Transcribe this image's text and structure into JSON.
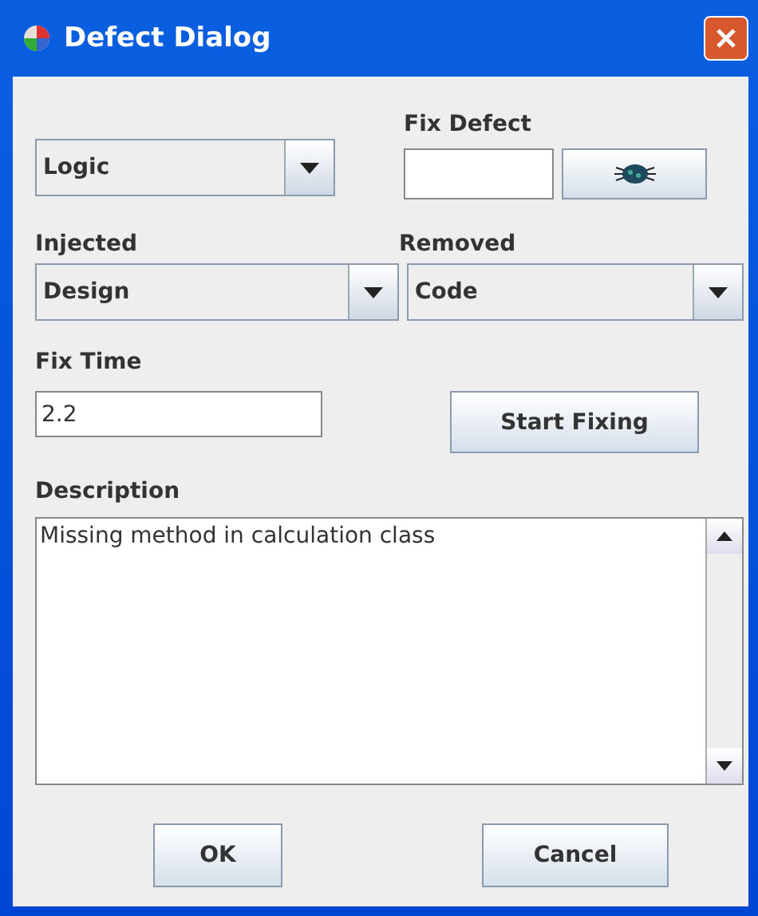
{
  "window": {
    "title": "Defect Dialog"
  },
  "defect_type": {
    "value": "Logic"
  },
  "fix_defect": {
    "label": "Fix Defect"
  },
  "injected": {
    "label": "Injected",
    "value": "Design"
  },
  "removed": {
    "label": "Removed",
    "value": "Code"
  },
  "fix_time": {
    "label": "Fix Time",
    "value": "2.2"
  },
  "start_button": "Start Fixing",
  "description": {
    "label": "Description",
    "value": "Missing method in calculation class"
  },
  "buttons": [
    "OK",
    "Cancel"
  ]
}
